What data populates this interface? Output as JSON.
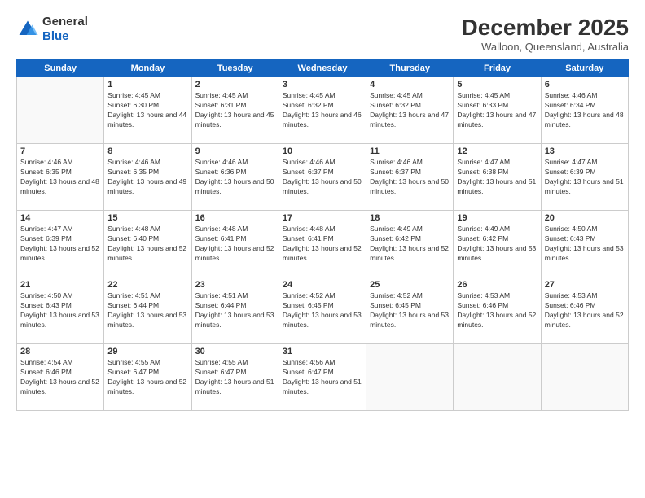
{
  "header": {
    "logo_general": "General",
    "logo_blue": "Blue",
    "month_title": "December 2025",
    "location": "Walloon, Queensland, Australia"
  },
  "weekdays": [
    "Sunday",
    "Monday",
    "Tuesday",
    "Wednesday",
    "Thursday",
    "Friday",
    "Saturday"
  ],
  "weeks": [
    [
      {
        "day": "",
        "sunrise": "",
        "sunset": "",
        "daylight": ""
      },
      {
        "day": "1",
        "sunrise": "Sunrise: 4:45 AM",
        "sunset": "Sunset: 6:30 PM",
        "daylight": "Daylight: 13 hours and 44 minutes."
      },
      {
        "day": "2",
        "sunrise": "Sunrise: 4:45 AM",
        "sunset": "Sunset: 6:31 PM",
        "daylight": "Daylight: 13 hours and 45 minutes."
      },
      {
        "day": "3",
        "sunrise": "Sunrise: 4:45 AM",
        "sunset": "Sunset: 6:32 PM",
        "daylight": "Daylight: 13 hours and 46 minutes."
      },
      {
        "day": "4",
        "sunrise": "Sunrise: 4:45 AM",
        "sunset": "Sunset: 6:32 PM",
        "daylight": "Daylight: 13 hours and 47 minutes."
      },
      {
        "day": "5",
        "sunrise": "Sunrise: 4:45 AM",
        "sunset": "Sunset: 6:33 PM",
        "daylight": "Daylight: 13 hours and 47 minutes."
      },
      {
        "day": "6",
        "sunrise": "Sunrise: 4:46 AM",
        "sunset": "Sunset: 6:34 PM",
        "daylight": "Daylight: 13 hours and 48 minutes."
      }
    ],
    [
      {
        "day": "7",
        "sunrise": "Sunrise: 4:46 AM",
        "sunset": "Sunset: 6:35 PM",
        "daylight": "Daylight: 13 hours and 48 minutes."
      },
      {
        "day": "8",
        "sunrise": "Sunrise: 4:46 AM",
        "sunset": "Sunset: 6:35 PM",
        "daylight": "Daylight: 13 hours and 49 minutes."
      },
      {
        "day": "9",
        "sunrise": "Sunrise: 4:46 AM",
        "sunset": "Sunset: 6:36 PM",
        "daylight": "Daylight: 13 hours and 50 minutes."
      },
      {
        "day": "10",
        "sunrise": "Sunrise: 4:46 AM",
        "sunset": "Sunset: 6:37 PM",
        "daylight": "Daylight: 13 hours and 50 minutes."
      },
      {
        "day": "11",
        "sunrise": "Sunrise: 4:46 AM",
        "sunset": "Sunset: 6:37 PM",
        "daylight": "Daylight: 13 hours and 50 minutes."
      },
      {
        "day": "12",
        "sunrise": "Sunrise: 4:47 AM",
        "sunset": "Sunset: 6:38 PM",
        "daylight": "Daylight: 13 hours and 51 minutes."
      },
      {
        "day": "13",
        "sunrise": "Sunrise: 4:47 AM",
        "sunset": "Sunset: 6:39 PM",
        "daylight": "Daylight: 13 hours and 51 minutes."
      }
    ],
    [
      {
        "day": "14",
        "sunrise": "Sunrise: 4:47 AM",
        "sunset": "Sunset: 6:39 PM",
        "daylight": "Daylight: 13 hours and 52 minutes."
      },
      {
        "day": "15",
        "sunrise": "Sunrise: 4:48 AM",
        "sunset": "Sunset: 6:40 PM",
        "daylight": "Daylight: 13 hours and 52 minutes."
      },
      {
        "day": "16",
        "sunrise": "Sunrise: 4:48 AM",
        "sunset": "Sunset: 6:41 PM",
        "daylight": "Daylight: 13 hours and 52 minutes."
      },
      {
        "day": "17",
        "sunrise": "Sunrise: 4:48 AM",
        "sunset": "Sunset: 6:41 PM",
        "daylight": "Daylight: 13 hours and 52 minutes."
      },
      {
        "day": "18",
        "sunrise": "Sunrise: 4:49 AM",
        "sunset": "Sunset: 6:42 PM",
        "daylight": "Daylight: 13 hours and 52 minutes."
      },
      {
        "day": "19",
        "sunrise": "Sunrise: 4:49 AM",
        "sunset": "Sunset: 6:42 PM",
        "daylight": "Daylight: 13 hours and 53 minutes."
      },
      {
        "day": "20",
        "sunrise": "Sunrise: 4:50 AM",
        "sunset": "Sunset: 6:43 PM",
        "daylight": "Daylight: 13 hours and 53 minutes."
      }
    ],
    [
      {
        "day": "21",
        "sunrise": "Sunrise: 4:50 AM",
        "sunset": "Sunset: 6:43 PM",
        "daylight": "Daylight: 13 hours and 53 minutes."
      },
      {
        "day": "22",
        "sunrise": "Sunrise: 4:51 AM",
        "sunset": "Sunset: 6:44 PM",
        "daylight": "Daylight: 13 hours and 53 minutes."
      },
      {
        "day": "23",
        "sunrise": "Sunrise: 4:51 AM",
        "sunset": "Sunset: 6:44 PM",
        "daylight": "Daylight: 13 hours and 53 minutes."
      },
      {
        "day": "24",
        "sunrise": "Sunrise: 4:52 AM",
        "sunset": "Sunset: 6:45 PM",
        "daylight": "Daylight: 13 hours and 53 minutes."
      },
      {
        "day": "25",
        "sunrise": "Sunrise: 4:52 AM",
        "sunset": "Sunset: 6:45 PM",
        "daylight": "Daylight: 13 hours and 53 minutes."
      },
      {
        "day": "26",
        "sunrise": "Sunrise: 4:53 AM",
        "sunset": "Sunset: 6:46 PM",
        "daylight": "Daylight: 13 hours and 52 minutes."
      },
      {
        "day": "27",
        "sunrise": "Sunrise: 4:53 AM",
        "sunset": "Sunset: 6:46 PM",
        "daylight": "Daylight: 13 hours and 52 minutes."
      }
    ],
    [
      {
        "day": "28",
        "sunrise": "Sunrise: 4:54 AM",
        "sunset": "Sunset: 6:46 PM",
        "daylight": "Daylight: 13 hours and 52 minutes."
      },
      {
        "day": "29",
        "sunrise": "Sunrise: 4:55 AM",
        "sunset": "Sunset: 6:47 PM",
        "daylight": "Daylight: 13 hours and 52 minutes."
      },
      {
        "day": "30",
        "sunrise": "Sunrise: 4:55 AM",
        "sunset": "Sunset: 6:47 PM",
        "daylight": "Daylight: 13 hours and 51 minutes."
      },
      {
        "day": "31",
        "sunrise": "Sunrise: 4:56 AM",
        "sunset": "Sunset: 6:47 PM",
        "daylight": "Daylight: 13 hours and 51 minutes."
      },
      {
        "day": "",
        "sunrise": "",
        "sunset": "",
        "daylight": ""
      },
      {
        "day": "",
        "sunrise": "",
        "sunset": "",
        "daylight": ""
      },
      {
        "day": "",
        "sunrise": "",
        "sunset": "",
        "daylight": ""
      }
    ]
  ]
}
